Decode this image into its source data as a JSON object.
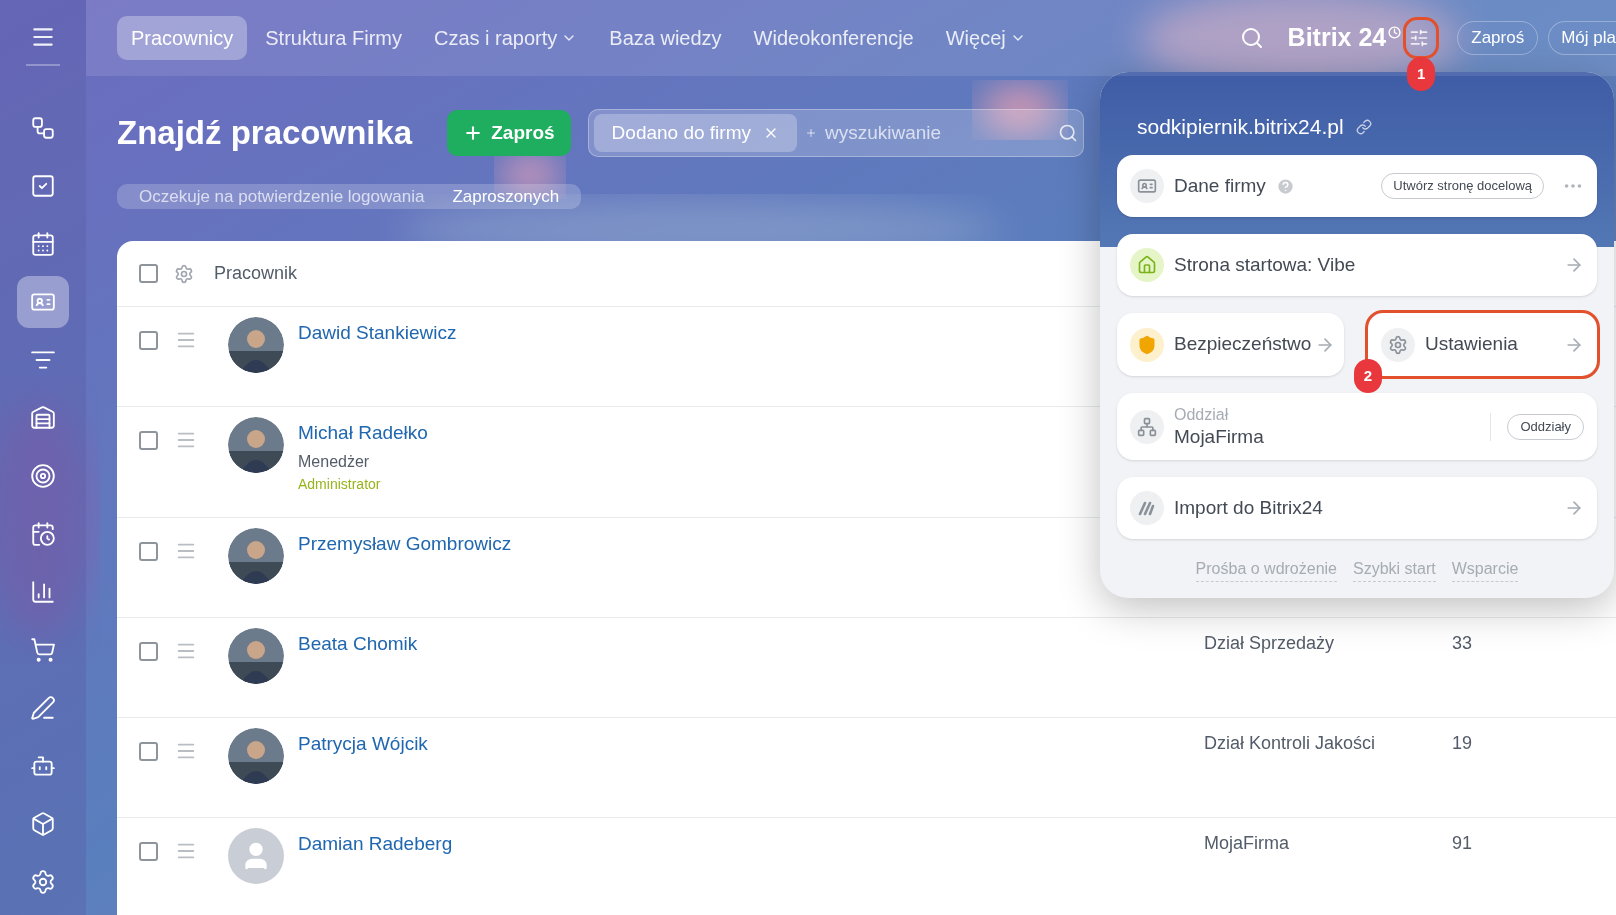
{
  "sidebar": {
    "items": [
      {
        "kind": "workflow",
        "selected": false
      },
      {
        "kind": "tasks",
        "selected": false
      },
      {
        "kind": "calendar",
        "selected": false
      },
      {
        "kind": "contacts",
        "selected": true
      },
      {
        "kind": "funnel",
        "selected": false
      },
      {
        "kind": "store",
        "selected": false
      },
      {
        "kind": "target",
        "selected": false
      },
      {
        "kind": "schedule",
        "selected": false
      },
      {
        "kind": "chart",
        "selected": false
      },
      {
        "kind": "cart",
        "selected": false
      },
      {
        "kind": "sign",
        "selected": false
      },
      {
        "kind": "robot",
        "selected": false
      },
      {
        "kind": "box",
        "selected": false
      },
      {
        "kind": "settings",
        "selected": false
      }
    ]
  },
  "nav": {
    "tabs": [
      {
        "label": "Pracownicy",
        "selected": true,
        "dropdown": false
      },
      {
        "label": "Struktura Firmy",
        "selected": false,
        "dropdown": false
      },
      {
        "label": "Czas i raporty",
        "selected": false,
        "dropdown": true
      },
      {
        "label": "Baza wiedzy",
        "selected": false,
        "dropdown": false
      },
      {
        "label": "Wideokonferencje",
        "selected": false,
        "dropdown": false
      },
      {
        "label": "Więcej",
        "selected": false,
        "dropdown": true
      }
    ],
    "logo": "Bitrix 24",
    "settings_annotation": "1",
    "invite": "Zaproś",
    "plan": "Mój pla"
  },
  "page": {
    "title": "Znajdź pracownika",
    "invite_button": "Zaproś",
    "filter_chip": "Dodano do firmy",
    "search": {
      "placeholder": "wyszukiwanie"
    },
    "subtabs": [
      {
        "label": "Oczekuje na potwierdzenie logowania",
        "selected": false
      },
      {
        "label": "Zaproszonych",
        "selected": true
      }
    ]
  },
  "table": {
    "header": {
      "checked": false,
      "column": "Pracownik"
    },
    "rows": [
      {
        "checked": false,
        "name": "Dawid Stankiewicz"
      },
      {
        "checked": false,
        "name": "Michał Radełko",
        "position": "Menedżer",
        "role": "Administrator"
      },
      {
        "checked": false,
        "name": "Przemysław Gombrowicz"
      },
      {
        "checked": false,
        "name": "Beata Chomik",
        "column_2": "Dział Sprzedaży",
        "column_3": "33"
      },
      {
        "checked": false,
        "name": "Patrycja Wójcik",
        "column_2": "Dział Kontroli Jakości",
        "column_3": "19"
      },
      {
        "checked": false,
        "kind": "placeholder",
        "name": "Damian Radeberg",
        "column_2": "MojaFirma",
        "column_3": "91"
      }
    ]
  },
  "popup": {
    "portal": "sodkipiernik.bitrix24.pl",
    "company": {
      "title": "Dane firmy",
      "button": "Utwórz stronę docelową"
    },
    "home": {
      "title": "Strona startowa: Vibe"
    },
    "security": {
      "title": "Bezpieczeństwo"
    },
    "settings": {
      "title": "Ustawienia",
      "annotation": "2"
    },
    "branch": {
      "label": "Oddział",
      "value": "MojaFirma",
      "button": "Oddziały"
    },
    "import": {
      "title": "Import do Bitrix24"
    },
    "links": [
      "Prośba o wdrożenie",
      "Szybki start",
      "Wsparcie"
    ]
  }
}
